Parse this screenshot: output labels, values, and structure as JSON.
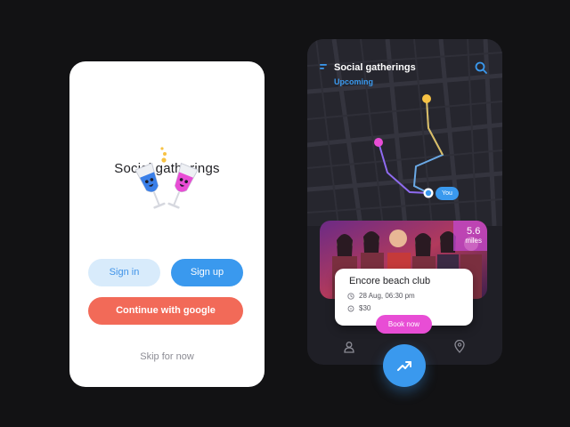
{
  "welcome_screen": {
    "title": "Social gatherings",
    "sign_in_label": "Sign in",
    "sign_up_label": "Sign up",
    "google_label": "Continue with google",
    "skip_label": "Skip for now"
  },
  "map_screen": {
    "title": "Social gatherings",
    "subtitle": "Upcoming",
    "you_label": "You",
    "event": {
      "distance_value": "5.6",
      "distance_unit": "miles",
      "name": "Encore beach club",
      "date": "28 Aug, 06:30 pm",
      "price": "$30",
      "book_label": "Book now"
    },
    "icons": [
      "menu-icon",
      "search-icon",
      "clock-icon",
      "tag-icon",
      "user-icon",
      "trend-up-icon",
      "location-pin-icon"
    ]
  },
  "colors": {
    "accent_blue": "#3a99ee",
    "accent_pink": "#e84dd5",
    "accent_coral": "#f26a58",
    "accent_yellow": "#f7c244",
    "dark_bg": "#1f1f26"
  }
}
